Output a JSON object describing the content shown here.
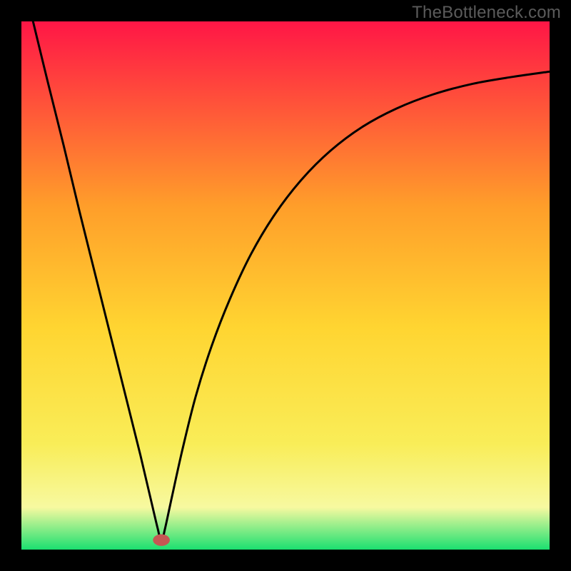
{
  "attribution": "TheBottleneck.com",
  "chart_data": {
    "type": "line",
    "title": "",
    "xlabel": "",
    "ylabel": "",
    "xlim": [
      0,
      1
    ],
    "ylim": [
      0,
      1
    ],
    "background_gradient": {
      "top": "#ff1646",
      "upper_mid": "#ff9e2a",
      "mid": "#ffd531",
      "lower_mid": "#f9ed58",
      "near_bottom": "#f7f9a0",
      "bottom": "#1be070"
    },
    "minimum_point": {
      "x": 0.265,
      "y": 0.015
    },
    "marker": {
      "x": 0.265,
      "y": 0.018,
      "color": "#C55753",
      "rx": 0.016,
      "ry": 0.011
    },
    "series": [
      {
        "name": "curve",
        "points": [
          {
            "x": 0.022,
            "y": 1.0
          },
          {
            "x": 0.05,
            "y": 0.885
          },
          {
            "x": 0.08,
            "y": 0.765
          },
          {
            "x": 0.11,
            "y": 0.64
          },
          {
            "x": 0.14,
            "y": 0.52
          },
          {
            "x": 0.17,
            "y": 0.4
          },
          {
            "x": 0.2,
            "y": 0.28
          },
          {
            "x": 0.225,
            "y": 0.18
          },
          {
            "x": 0.245,
            "y": 0.095
          },
          {
            "x": 0.258,
            "y": 0.04
          },
          {
            "x": 0.265,
            "y": 0.015
          },
          {
            "x": 0.272,
            "y": 0.04
          },
          {
            "x": 0.285,
            "y": 0.1
          },
          {
            "x": 0.305,
            "y": 0.19
          },
          {
            "x": 0.33,
            "y": 0.29
          },
          {
            "x": 0.36,
            "y": 0.385
          },
          {
            "x": 0.395,
            "y": 0.475
          },
          {
            "x": 0.435,
            "y": 0.56
          },
          {
            "x": 0.48,
            "y": 0.635
          },
          {
            "x": 0.53,
            "y": 0.7
          },
          {
            "x": 0.585,
            "y": 0.755
          },
          {
            "x": 0.645,
            "y": 0.8
          },
          {
            "x": 0.71,
            "y": 0.835
          },
          {
            "x": 0.78,
            "y": 0.862
          },
          {
            "x": 0.855,
            "y": 0.882
          },
          {
            "x": 0.93,
            "y": 0.895
          },
          {
            "x": 1.0,
            "y": 0.905
          }
        ]
      }
    ]
  }
}
